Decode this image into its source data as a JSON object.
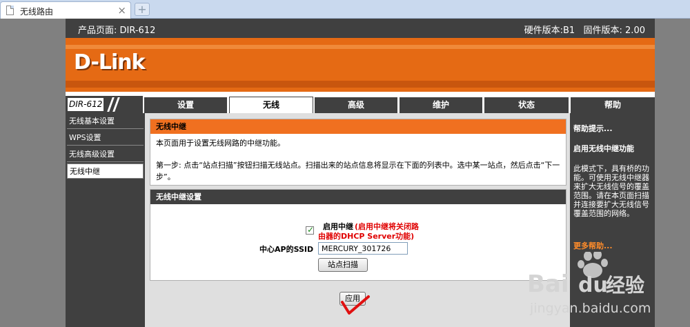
{
  "browser": {
    "tab_title": "无线路由",
    "close_glyph": "×",
    "newtab_glyph": "+"
  },
  "header": {
    "product": "产品页面: DIR-612",
    "versions": "硬件版本:B1   固件版本: 2.00",
    "logo": "D-Link"
  },
  "nav": {
    "model": "DIR-612",
    "tabs": [
      "设置",
      "无线",
      "高级",
      "维护",
      "状态",
      "帮助"
    ],
    "active_tab": "无线"
  },
  "sidebar": {
    "items": [
      {
        "label": "无线基本设置"
      },
      {
        "label": "WPS设置"
      },
      {
        "label": "无线高级设置"
      },
      {
        "label": "无线中继"
      }
    ],
    "active_item": "无线中继"
  },
  "intro_panel": {
    "title": "无线中继",
    "desc": "本页面用于设置无线网路的中继功能。",
    "step_line1": "第一步: 点击“站点扫描”按钮扫描无线站点。扫描出来的站点信息将显示在下面的列表中。选中某一站点，然后点击“下一",
    "step_line2": "步”。"
  },
  "settings_panel": {
    "title": "无线中继设置",
    "enable_label": "启用中继",
    "enable_checked": true,
    "enable_warning_line1": "(启用中继将关闭路",
    "enable_warning_line2": "由器的DHCP Server功能)",
    "ssid_label": "中心AP的SSID",
    "ssid_value": "MERCURY_301726",
    "scan_button": "站点扫描"
  },
  "apply_button": "应用",
  "help": {
    "tips_title": "帮助提示...",
    "section_title": "启用无线中继功能",
    "lines": [
      "此模式下，具有桥的功",
      "能。可使用无线中继器",
      "来扩大无线信号的覆盖",
      "范围。请在本页面扫描",
      "并连接要扩大无线信号",
      "覆盖范围的网络。"
    ],
    "more": "更多帮助..."
  },
  "watermark": {
    "brand_left": "Bai",
    "brand_right": "du",
    "brand_cn": "经验",
    "url": "jingyan.baidu.com"
  },
  "colors": {
    "orange": "#e56a14",
    "dark": "#404040",
    "red_warning": "#e00000",
    "checkmark_red": "#e01010"
  }
}
